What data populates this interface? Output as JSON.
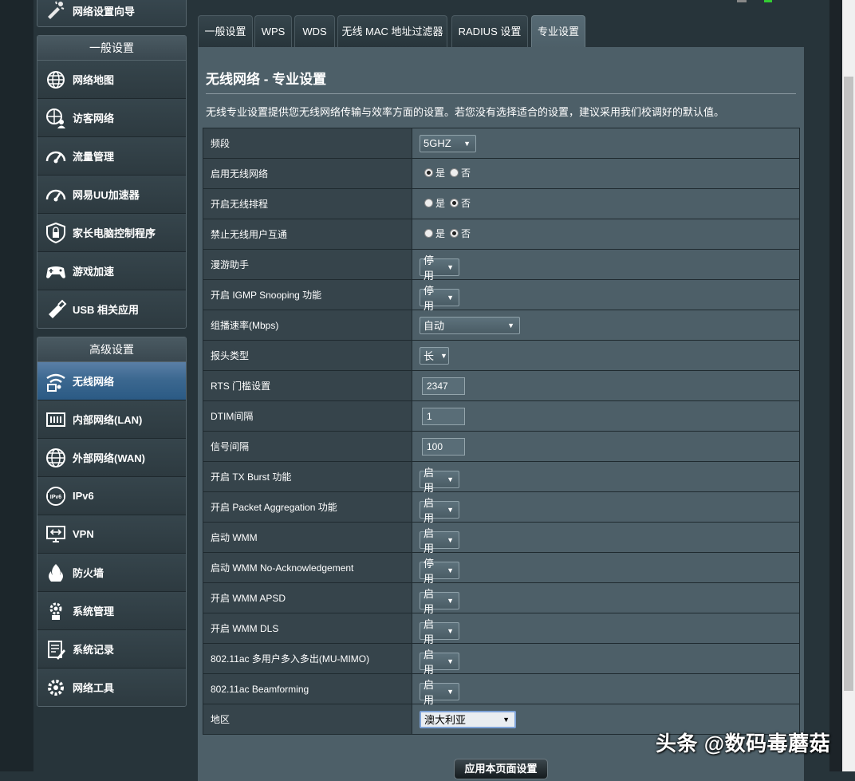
{
  "sidebar": {
    "top_item": "网络设置向导",
    "general_header": "一般设置",
    "general_items": [
      {
        "label": "网络地图",
        "icon": "globe-network-icon"
      },
      {
        "label": "访客网络",
        "icon": "guest-network-icon"
      },
      {
        "label": "流量管理",
        "icon": "speedometer-icon"
      },
      {
        "label": "网易UU加速器",
        "icon": "uu-speedometer-icon"
      },
      {
        "label": "家长电脑控制程序",
        "icon": "shield-lock-icon"
      },
      {
        "label": "游戏加速",
        "icon": "gamepad-icon"
      },
      {
        "label": "USB 相关应用",
        "icon": "usb-icon"
      }
    ],
    "advanced_header": "高级设置",
    "advanced_items": [
      {
        "label": "无线网络",
        "icon": "wifi-icon",
        "active": true
      },
      {
        "label": "内部网络(LAN)",
        "icon": "lan-icon"
      },
      {
        "label": "外部网络(WAN)",
        "icon": "wan-globe-icon"
      },
      {
        "label": "IPv6",
        "icon": "ipv6-globe-icon"
      },
      {
        "label": "VPN",
        "icon": "vpn-icon"
      },
      {
        "label": "防火墙",
        "icon": "firewall-icon"
      },
      {
        "label": "系统管理",
        "icon": "system-gear-icon"
      },
      {
        "label": "系统记录",
        "icon": "log-icon"
      },
      {
        "label": "网络工具",
        "icon": "tools-gear-icon"
      }
    ]
  },
  "tabs": [
    "一般设置",
    "WPS",
    "WDS",
    "无线 MAC 地址过滤器",
    "RADIUS 设置",
    "专业设置"
  ],
  "active_tab": "专业设置",
  "page": {
    "title": "无线网络 - 专业设置",
    "description": "无线专业设置提供您无线网络传输与效率方面的设置。若您没有选择适合的设置，建议采用我们校调好的默认值。"
  },
  "radio_labels": {
    "yes": "是",
    "no": "否"
  },
  "settings": [
    {
      "label": "频段",
      "type": "select",
      "value": "5GHZ"
    },
    {
      "label": "启用无线网络",
      "type": "radio",
      "value": "yes"
    },
    {
      "label": "开启无线排程",
      "type": "radio",
      "value": "no"
    },
    {
      "label": "禁止无线用户互通",
      "type": "radio",
      "value": "no"
    },
    {
      "label": "漫游助手",
      "type": "select",
      "value": "停用"
    },
    {
      "label": "开启 IGMP Snooping 功能",
      "type": "select",
      "value": "停用"
    },
    {
      "label": "组播速率(Mbps)",
      "type": "select",
      "value": "自动",
      "wide": true
    },
    {
      "label": "报头类型",
      "type": "select",
      "value": "长"
    },
    {
      "label": "RTS 门槛设置",
      "type": "text",
      "value": "2347"
    },
    {
      "label": "DTIM间隔",
      "type": "text",
      "value": "1"
    },
    {
      "label": "信号间隔",
      "type": "text",
      "value": "100"
    },
    {
      "label": "开启 TX Burst 功能",
      "type": "select",
      "value": "启用"
    },
    {
      "label": "开启 Packet Aggregation 功能",
      "type": "select",
      "value": "启用"
    },
    {
      "label": "启动 WMM",
      "type": "select",
      "value": "启用"
    },
    {
      "label": "启动 WMM No-Acknowledgement",
      "type": "select",
      "value": "停用"
    },
    {
      "label": "开启 WMM APSD",
      "type": "select",
      "value": "启用"
    },
    {
      "label": "开启 WMM DLS",
      "type": "select",
      "value": "启用"
    },
    {
      "label": "802.11ac 多用户多入多出(MU-MIMO)",
      "type": "select",
      "value": "启用"
    },
    {
      "label": "802.11ac Beamforming",
      "type": "select",
      "value": "启用"
    },
    {
      "label": "地区",
      "type": "select",
      "value": "澳大利亚",
      "region": true
    }
  ],
  "apply_button": "应用本页面设置",
  "watermark": "头条 @数码毒蘑菇",
  "colors": {
    "accent_blue": "#3c6890",
    "panel": "#4d5f68",
    "label_cell": "#36444b",
    "indicator_green": "#33cc33"
  }
}
